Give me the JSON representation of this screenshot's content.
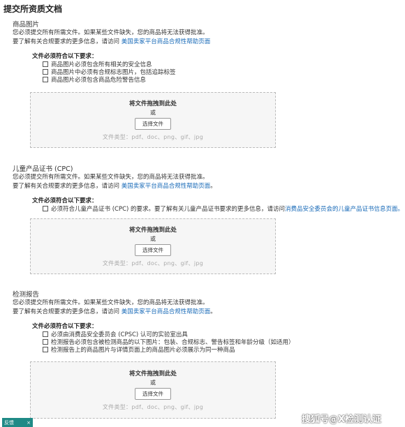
{
  "page_title": "提交所资质文档",
  "common": {
    "missing_notice": "您必须提交所有所需文件。如果某些文件缺失，您的商品将无法获得批准。",
    "learn_more_prefix": "要了解有关合规要求的更多信息，请访问",
    "help_link": "美国卖家平台商品合规性帮助页面",
    "req_title": "文件必须符合以下要求：",
    "drop_title": "将文件拖拽到此处",
    "or": "或",
    "choose_file": "选择文件",
    "file_types": "文件类型：pdf、doc、png、gif、jpg"
  },
  "sections": [
    {
      "title": "商品图片",
      "learn_suffix": "",
      "requirements": [
        {
          "text": "商品图片必须包含所有相关的安全信息"
        },
        {
          "text": "商品图片中必须有合规标志图片，包括追踪标签"
        },
        {
          "text": "商品图片必须包含商品危险警告信息"
        }
      ]
    },
    {
      "title": "儿童产品证书 (CPC)",
      "learn_suffix": "。",
      "requirements": [
        {
          "text": "必须符合儿童产品证书 (CPC) 的要求。要了解有关儿童产品证书要求的更多信息，请访问",
          "link": "消费品安全委员会的儿童产品证书信息页面。"
        }
      ]
    },
    {
      "title": "检测报告",
      "learn_suffix": "。",
      "requirements": [
        {
          "text": "必须由消费品安全委员会 (CPSC) 认可的实验室出具"
        },
        {
          "text": "检测报告必须包含被检测商品的以下图片：包装、合规标志、警告标签和年龄分级（如适用）"
        },
        {
          "text": "检测报告上的商品图片与详情页面上的商品图片必须展示为同一种商品"
        }
      ]
    }
  ],
  "feedback_label": "反馈",
  "feedback_close": "×",
  "watermark": "搜狐号@X检测认证"
}
